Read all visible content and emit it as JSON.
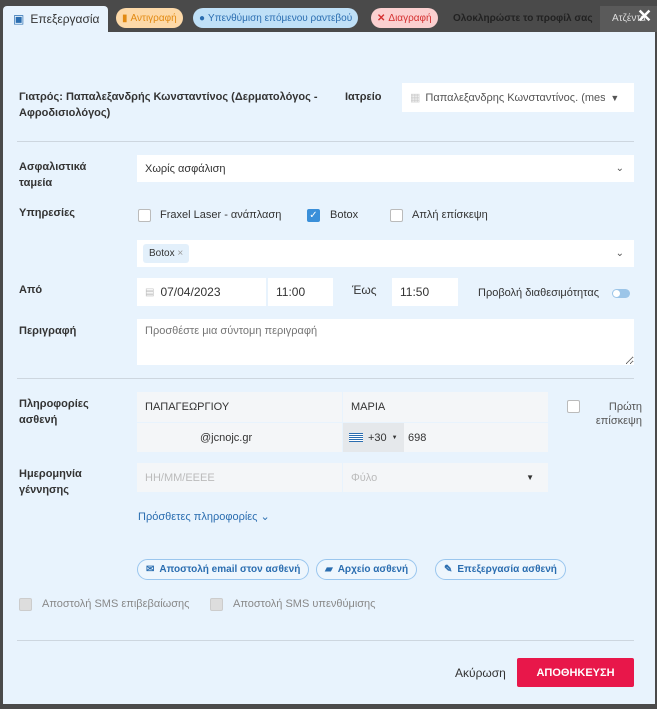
{
  "tabs": {
    "edit": "Επεξεργασία",
    "copy": "Αντιγραφή",
    "reminder": "Υπενθύμιση επόμενου ραντεβού",
    "delete": "Διαγραφή",
    "complete_profile": "Ολοκληρώστε το προφίλ σας",
    "agenda": "Ατζέντα"
  },
  "doctor": {
    "label": "Γιατρός: Παπαλεξανδρής Κωνσταντίνος (Δερματολόγος - Αφροδισιολόγος)",
    "clinic_label": "Ιατρείο",
    "clinic_value": "Παπαλεξανδρης Κωνσταντίνος. (mes"
  },
  "insurance": {
    "label": "Ασφαλιστικά ταμεία",
    "value": "Χωρίς ασφάλιση"
  },
  "services": {
    "label": "Υπηρεσίες",
    "options": [
      {
        "label": "Fraxel Laser - ανάπλαση",
        "checked": false
      },
      {
        "label": "Botox",
        "checked": true
      },
      {
        "label": "Απλή επίσκεψη",
        "checked": false
      }
    ],
    "selected_tag": "Botox"
  },
  "time": {
    "from_label": "Από",
    "date": "07/04/2023",
    "start": "11:00",
    "to_label": "Έως",
    "end": "11:50",
    "availability_label": "Προβολή διαθεσιμότητας",
    "availability_on": false
  },
  "description": {
    "label": "Περιγραφή",
    "placeholder": "Προσθέστε μια σύντομη περιγραφή"
  },
  "patient": {
    "label": "Πληροφορίες ασθενή",
    "last_name": "ΠΑΠΑΓΕΩΡΓΙΟΥ",
    "first_name": "ΜΑΡΙΑ",
    "email": "@jcnojc.gr",
    "phone_code": "+30",
    "phone": "698",
    "first_visit_label": "Πρώτη επίσκεψη",
    "dob_label": "Ημερομηνία γέννησης",
    "dob_placeholder": "ΗΗ/ΜΜ/ΕΕΕΕ",
    "gender_placeholder": "Φύλο",
    "more_info": "Πρόσθετες πληροφορίες"
  },
  "actions": {
    "email": "Αποστολή email στον ασθενή",
    "file": "Αρχείο ασθενή",
    "edit": "Επεξεργασία ασθενή"
  },
  "sms": {
    "confirm": "Αποστολή SMS επιβεβαίωσης",
    "reminder": "Αποστολή SMS υπενθύμισης"
  },
  "footer": {
    "cancel": "Ακύρωση",
    "save": "ΑΠΟΘΗΚΕΥΣΗ"
  },
  "colors": {
    "accent": "#e8174a",
    "background": "#e8f3fd",
    "link": "#2a6db0"
  }
}
